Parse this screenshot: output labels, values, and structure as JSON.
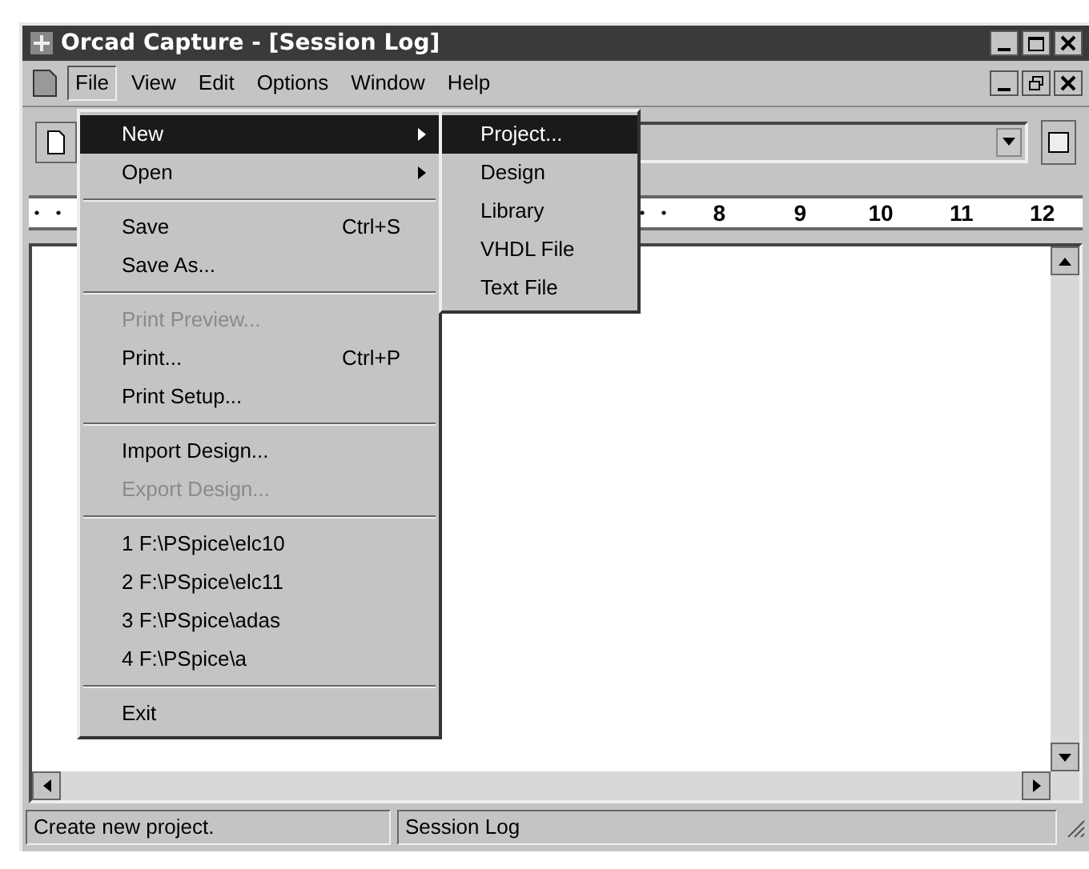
{
  "window": {
    "title": "Orcad Capture - [Session Log]"
  },
  "menu_bar": [
    {
      "label": "File",
      "selected": true
    },
    {
      "label": "View",
      "selected": false
    },
    {
      "label": "Edit",
      "selected": false
    },
    {
      "label": "Options",
      "selected": false
    },
    {
      "label": "Window",
      "selected": false
    },
    {
      "label": "Help",
      "selected": false
    }
  ],
  "file_menu": [
    {
      "kind": "item",
      "label": "New",
      "submenu": true,
      "selected": true,
      "disabled": false
    },
    {
      "kind": "item",
      "label": "Open",
      "submenu": true,
      "selected": false,
      "disabled": false
    },
    {
      "kind": "separator"
    },
    {
      "kind": "item",
      "label": "Save",
      "shortcut": "Ctrl+S",
      "submenu": false,
      "selected": false,
      "disabled": false
    },
    {
      "kind": "item",
      "label": "Save As...",
      "submenu": false,
      "selected": false,
      "disabled": false
    },
    {
      "kind": "separator"
    },
    {
      "kind": "item",
      "label": "Print Preview...",
      "submenu": false,
      "selected": false,
      "disabled": true
    },
    {
      "kind": "item",
      "label": "Print...",
      "shortcut": "Ctrl+P",
      "submenu": false,
      "selected": false,
      "disabled": false
    },
    {
      "kind": "item",
      "label": "Print Setup...",
      "submenu": false,
      "selected": false,
      "disabled": false
    },
    {
      "kind": "separator"
    },
    {
      "kind": "item",
      "label": "Import Design...",
      "submenu": false,
      "selected": false,
      "disabled": false
    },
    {
      "kind": "item",
      "label": "Export Design...",
      "submenu": false,
      "selected": false,
      "disabled": true
    },
    {
      "kind": "separator"
    },
    {
      "kind": "item",
      "label": "1 F:\\PSpice\\elc10",
      "submenu": false,
      "selected": false,
      "disabled": false
    },
    {
      "kind": "item",
      "label": "2 F:\\PSpice\\elc11",
      "submenu": false,
      "selected": false,
      "disabled": false
    },
    {
      "kind": "item",
      "label": "3 F:\\PSpice\\adas",
      "submenu": false,
      "selected": false,
      "disabled": false
    },
    {
      "kind": "item",
      "label": "4 F:\\PSpice\\a",
      "submenu": false,
      "selected": false,
      "disabled": false
    },
    {
      "kind": "separator"
    },
    {
      "kind": "item",
      "label": "Exit",
      "submenu": false,
      "selected": false,
      "disabled": false
    }
  ],
  "new_submenu": [
    {
      "label": "Project...",
      "selected": true
    },
    {
      "label": "Design",
      "selected": false
    },
    {
      "label": "Library",
      "selected": false
    },
    {
      "label": "VHDL File",
      "selected": false
    },
    {
      "label": "Text File",
      "selected": false
    }
  ],
  "ruler": [
    "8",
    "9",
    "10",
    "11",
    "12"
  ],
  "status_bar": [
    "Create new project.",
    "Session Log"
  ]
}
